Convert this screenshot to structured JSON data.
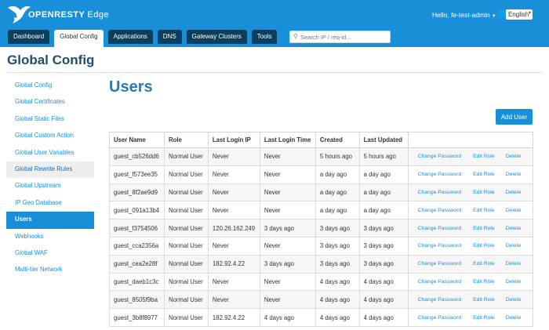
{
  "app": {
    "brand_prefix": "OPENRESTY",
    "brand_suffix": "Edge"
  },
  "header": {
    "greeting": "Hello, fe-test-admin",
    "language": "English",
    "tabs": [
      {
        "label": "Dashboard",
        "active": false
      },
      {
        "label": "Global Config",
        "active": true
      },
      {
        "label": "Applications",
        "active": false
      },
      {
        "label": "DNS",
        "active": false
      },
      {
        "label": "Gateway Clusters",
        "active": false
      },
      {
        "label": "Tools",
        "active": false
      }
    ],
    "search_placeholder": "Search IP / req-id..."
  },
  "page": {
    "title": "Global Config"
  },
  "sidebar": {
    "items": [
      {
        "label": "Global Config",
        "state": "normal"
      },
      {
        "label": "Global Certificates",
        "state": "normal"
      },
      {
        "label": "Global Static Files",
        "state": "normal"
      },
      {
        "label": "Global Custom Action",
        "state": "normal"
      },
      {
        "label": "Global User Variables",
        "state": "normal"
      },
      {
        "label": "Global Rewrite Rules",
        "state": "hover"
      },
      {
        "label": "Global Upstream",
        "state": "normal"
      },
      {
        "label": "IP Geo Database",
        "state": "normal"
      },
      {
        "label": "Users",
        "state": "active"
      },
      {
        "label": "Webhooks",
        "state": "normal"
      },
      {
        "label": "Global WAF",
        "state": "normal"
      },
      {
        "label": "Multi-tier Network",
        "state": "normal"
      }
    ]
  },
  "main": {
    "title": "Users",
    "add_user_label": "Add User",
    "columns": [
      "User Name",
      "Role",
      "Last Login IP",
      "Last Login Time",
      "Created",
      "Last Updated",
      ""
    ],
    "actions": {
      "change_password": "Change Password",
      "edit_role": "Edit Role",
      "delete": "Delete"
    },
    "rows": [
      [
        "guest_cb526dd6",
        "Normal User",
        "Never",
        "Never",
        "5 hours ago",
        "5 hours ago"
      ],
      [
        "guest_f573ee35",
        "Normal User",
        "Never",
        "Never",
        "a day ago",
        "a day ago"
      ],
      [
        "guest_8f2ae9d9",
        "Normal User",
        "Never",
        "Never",
        "a day ago",
        "a day ago"
      ],
      [
        "guest_091a13b4",
        "Normal User",
        "Never",
        "Never",
        "a day ago",
        "a day ago"
      ],
      [
        "guest_f3754506",
        "Normal User",
        "120.26.162.249",
        "3 days ago",
        "3 days ago",
        "3 days ago"
      ],
      [
        "guest_cca2356a",
        "Normal User",
        "Never",
        "Never",
        "3 days ago",
        "3 days ago"
      ],
      [
        "guest_cea2e28f",
        "Normal User",
        "182.92.4.22",
        "3 days ago",
        "3 days ago",
        "3 days ago"
      ],
      [
        "guest_daeb1c3c",
        "Normal User",
        "Never",
        "Never",
        "4 days ago",
        "4 days ago"
      ],
      [
        "guest_8505f9ba",
        "Normal User",
        "Never",
        "Never",
        "4 days ago",
        "4 days ago"
      ],
      [
        "guest_3b8f8977",
        "Normal User",
        "182.92.4.22",
        "4 days ago",
        "4 days ago",
        "4 days ago"
      ]
    ]
  },
  "colors": {
    "header_bg": "#1a8fd9",
    "tab_bg": "#0b3f5e",
    "accent": "#1a8fd9",
    "title": "#2a7ab3"
  },
  "icons": {
    "logo": "bird-logo-icon",
    "language": "globe-icon",
    "search": "search-icon",
    "caret": "caret-down-icon"
  }
}
